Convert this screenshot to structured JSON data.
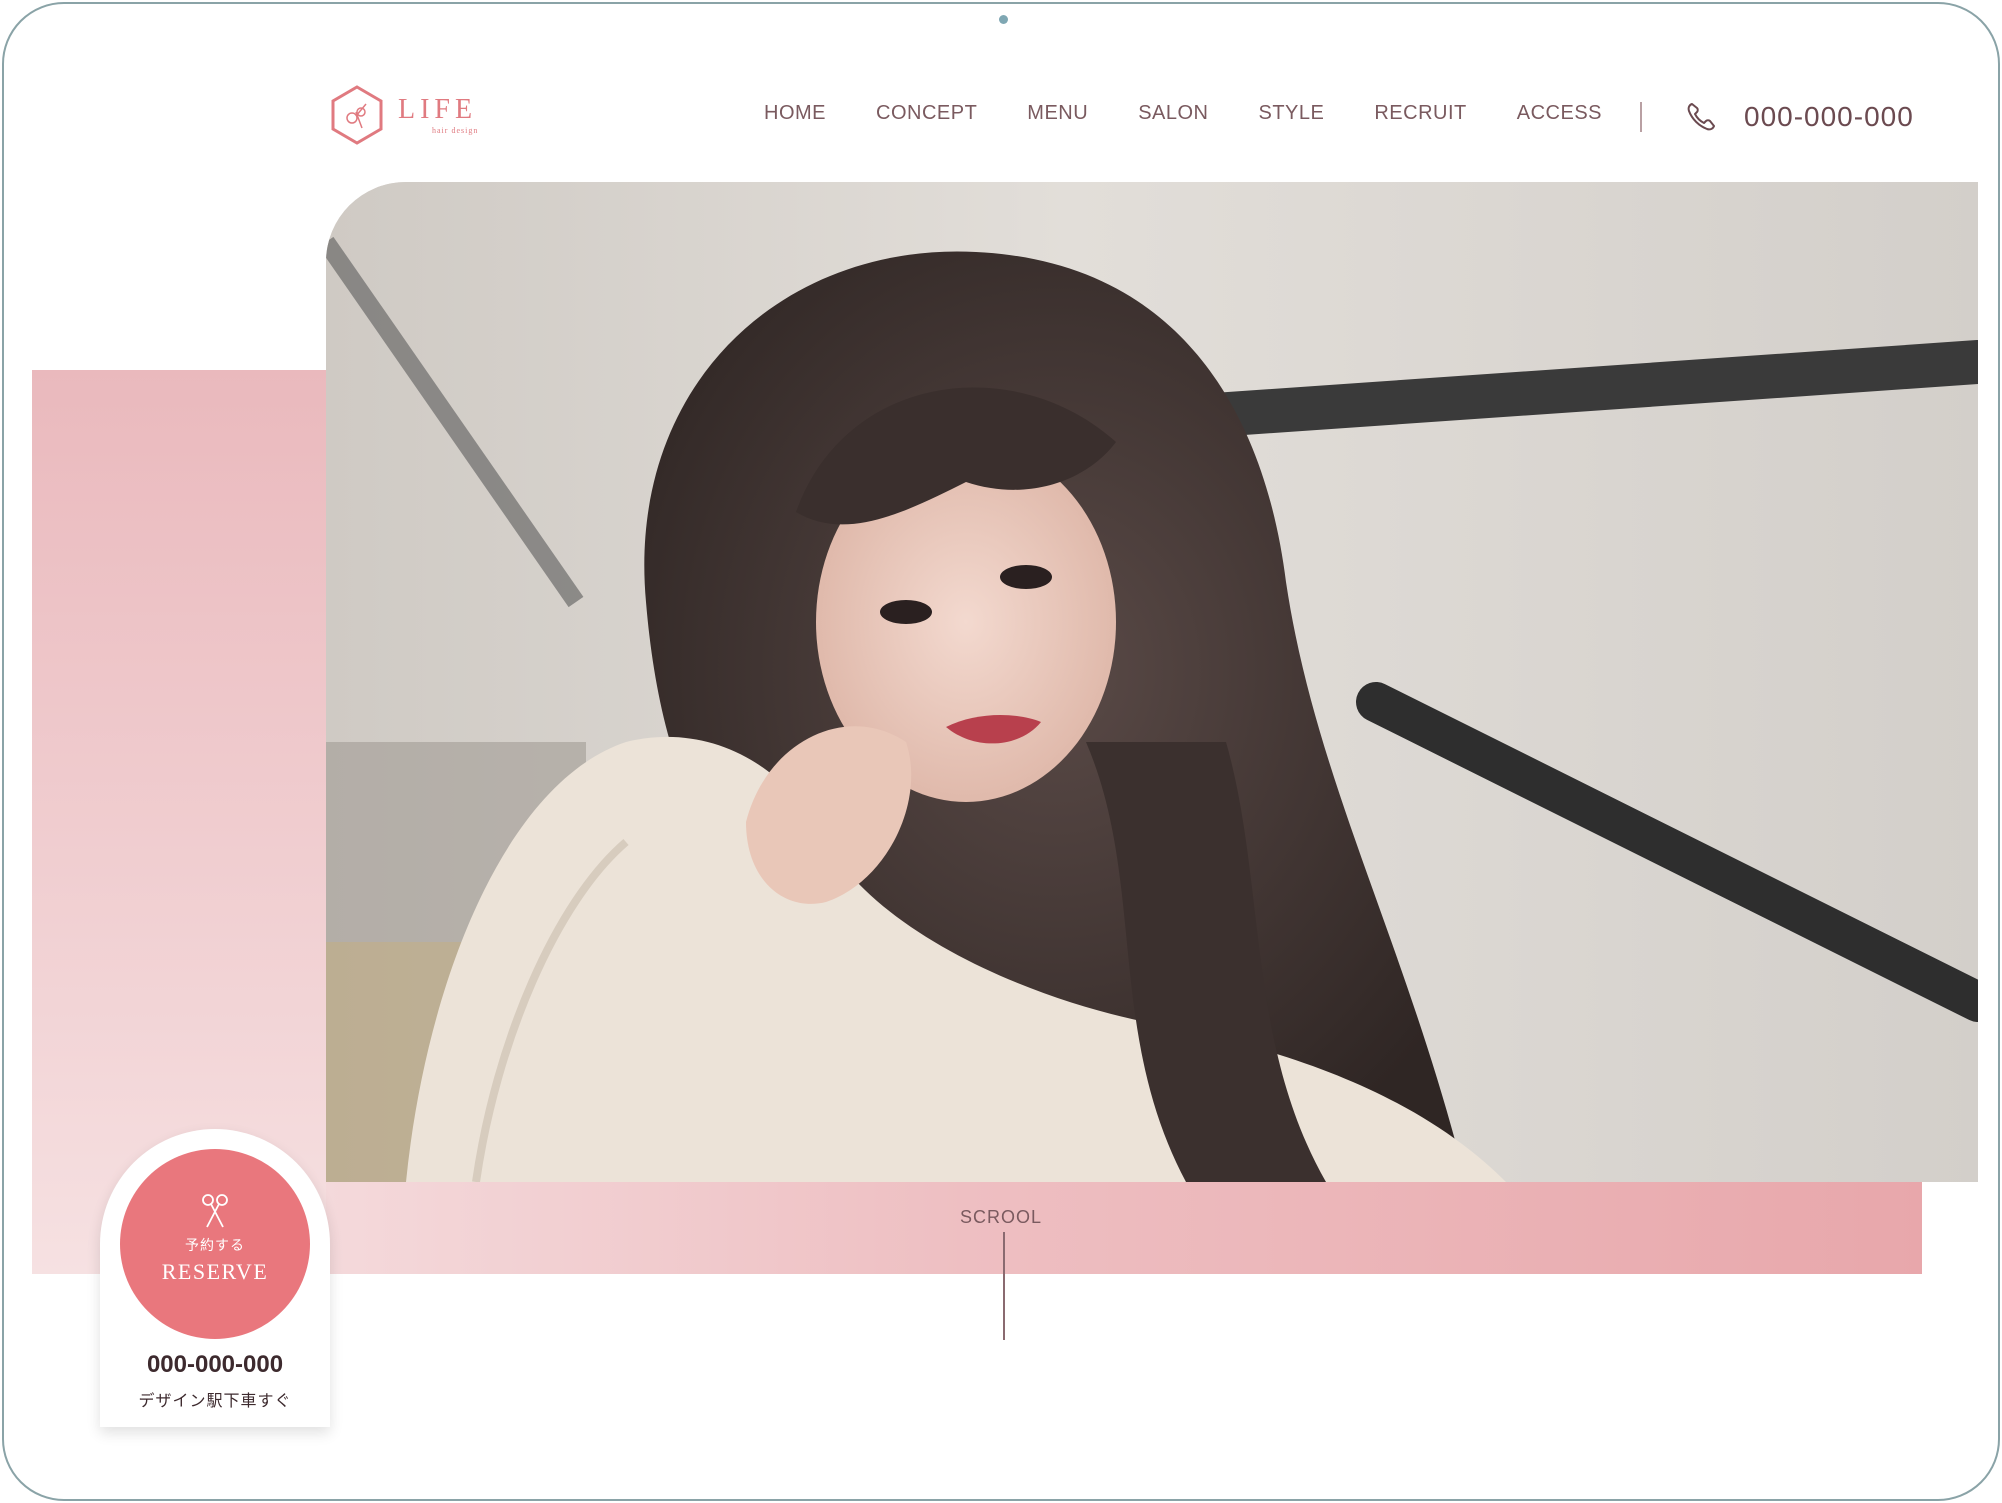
{
  "brand": {
    "name": "LIFE",
    "tagline": "hair design",
    "accent_color": "#e07a80"
  },
  "nav": {
    "items": [
      "HOME",
      "CONCEPT",
      "MENU",
      "SALON",
      "STYLE",
      "RECRUIT",
      "ACCESS"
    ]
  },
  "header": {
    "phone": "000-000-000",
    "phone_icon": "phone-icon"
  },
  "hero": {
    "image": "photo of woman with long brown wavy hair in white knit sweater"
  },
  "scroll": {
    "label": "SCROOL"
  },
  "reserve": {
    "label_jp": "予約する",
    "label_en": "RESERVE",
    "icon": "scissors-icon",
    "phone": "000-000-000",
    "station": "デザイン駅下車すぐ",
    "button_color": "#e9777d"
  }
}
